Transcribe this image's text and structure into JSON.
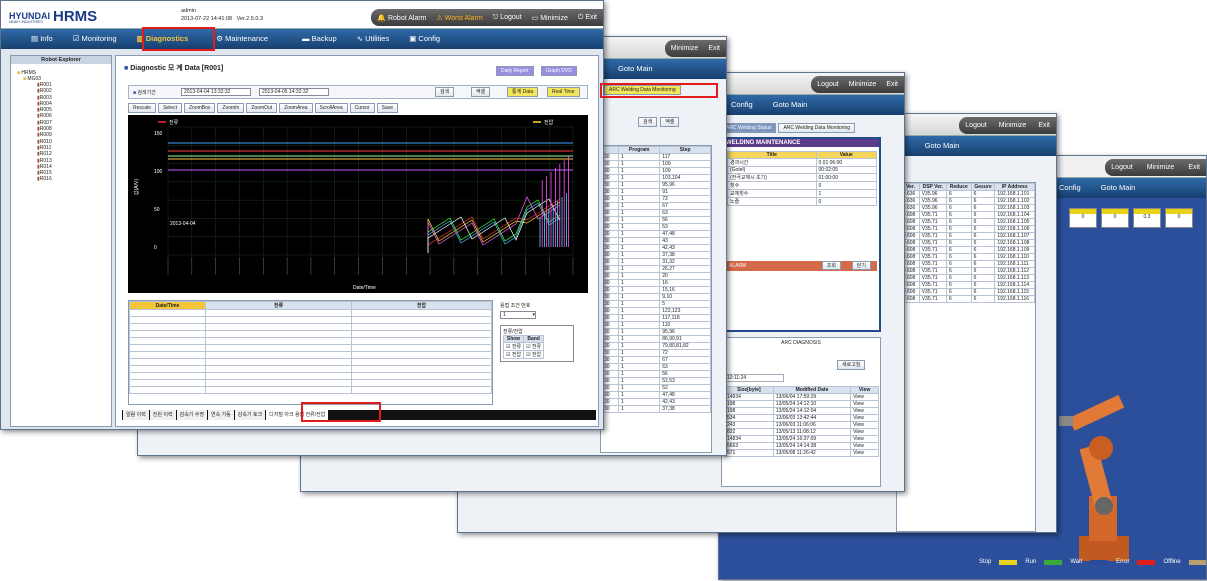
{
  "app": {
    "logo_brand": "HYUNDAI",
    "logo_sub": "HEAVY INDUSTRIES",
    "logo_product": "HRMS",
    "user": "admin",
    "datetime": "2013-07-22 14:41:08",
    "version": "Ver.2.5.0.3"
  },
  "topbar": {
    "robot_alarm": "Robot Alarm",
    "worst_alarm": "Worst Alarm",
    "logout": "Logout",
    "minimize": "Minimize",
    "exit": "Exit"
  },
  "nav": {
    "tabs": [
      "Info",
      "Monitoring",
      "Diagnostics",
      "Maintenance",
      "Backup",
      "Utilities",
      "Config"
    ],
    "goto_main": "Goto Main"
  },
  "explorer": {
    "title": "Robot Explorer",
    "root": "HRMS",
    "group": "MG03",
    "robots": [
      "R001",
      "R002",
      "R003",
      "R004",
      "R005",
      "R006",
      "R007",
      "R008",
      "R009",
      "R010",
      "R011",
      "R012",
      "R013",
      "R014",
      "R015",
      "R016"
    ]
  },
  "diagnostic": {
    "title": "Diagnostic 모 계 Data [R001]",
    "daily_report": "Daily Report",
    "graph_dvd": "Graph DVD",
    "period_label": "검색기간",
    "date_from": "2013-04-04 13:32:32",
    "date_to": "2013-04-05 14:32:32",
    "search": "검색",
    "print": "엑셀",
    "stats_data": "통계 Data",
    "real_time": "Real Time",
    "toolbar": [
      "Rescale",
      "Select",
      "ZoomBox",
      "ZoomIn",
      "ZoomOut",
      "ZoomArea",
      "ScrollArea",
      "Cursor",
      "Save"
    ],
    "legend_left": "전류",
    "legend_right": "전압",
    "y_axis_label": "값(A/V)",
    "x_axis_label": "Date/Time",
    "chart_date": "2013-04-04",
    "y_ticks": [
      "150",
      "100",
      "50",
      "0"
    ],
    "table_headers": [
      "Date/Time",
      "전류",
      "전압"
    ],
    "side_label": "용접 조건 번호",
    "side_value": "1",
    "show_label": "전류/전압",
    "show_col": "Show",
    "band_col": "Band",
    "opt1": "전류",
    "opt2": "전압",
    "bottom_tabs": [
      "알람 이력",
      "전원 이력",
      "감속기 수명",
      "연속 가동",
      "감속기 토크",
      "디지털 아크 용접 전류/전압"
    ]
  },
  "win2": {
    "tab": "ARC Welding Data Monitoring",
    "headers": [
      "",
      "Program",
      "Step"
    ],
    "rows": [
      [
        "30",
        "1",
        "117"
      ],
      [
        "30",
        "1",
        "109"
      ],
      [
        "30",
        "1",
        "109"
      ],
      [
        "30",
        "1",
        "103,104"
      ],
      [
        "30",
        "1",
        "95,96"
      ],
      [
        "30",
        "1",
        "91"
      ],
      [
        "30",
        "1",
        "72"
      ],
      [
        "30",
        "1",
        "67"
      ],
      [
        "30",
        "1",
        "63"
      ],
      [
        "30",
        "1",
        "56"
      ],
      [
        "30",
        "1",
        "53"
      ],
      [
        "30",
        "1",
        "47,48"
      ],
      [
        "30",
        "1",
        "43"
      ],
      [
        "30",
        "1",
        "42,43"
      ],
      [
        "30",
        "1",
        "37,38"
      ],
      [
        "30",
        "1",
        "31,32"
      ],
      [
        "30",
        "1",
        "26,27"
      ],
      [
        "30",
        "1",
        "20"
      ],
      [
        "30",
        "1",
        "16"
      ],
      [
        "30",
        "1",
        "15,16"
      ],
      [
        "30",
        "1",
        "9,10"
      ],
      [
        "30",
        "1",
        "5"
      ],
      [
        "30",
        "1",
        "122,123"
      ],
      [
        "30",
        "1",
        "117,118"
      ],
      [
        "30",
        "1",
        "110"
      ],
      [
        "30",
        "1",
        "95,96"
      ],
      [
        "30",
        "1",
        "86,90,91"
      ],
      [
        "30",
        "1",
        "79,80,81,82"
      ],
      [
        "30",
        "1",
        "72"
      ],
      [
        "30",
        "1",
        "67"
      ],
      [
        "30",
        "1",
        "63"
      ],
      [
        "30",
        "1",
        "56"
      ],
      [
        "30",
        "1",
        "52,53"
      ],
      [
        "30",
        "1",
        "52"
      ],
      [
        "30",
        "1",
        "47,48"
      ],
      [
        "30",
        "1",
        "42,43"
      ],
      [
        "30",
        "1",
        "37,38"
      ]
    ]
  },
  "win3": {
    "tabs": [
      "ARC Welding Status",
      "ARC Welding Data Monitoring"
    ],
    "section": "WELDING MAINTENANCE",
    "headers": [
      "Title",
      "Value"
    ],
    "rows": [
      [
        "경과시간",
        "0 01 06:00"
      ],
      [
        "(Gotel)",
        "00:02:05"
      ],
      [
        "(전극교체시 초기)",
        "01:00:00"
      ],
      [
        "횟수",
        "0"
      ],
      [
        "교체횟수",
        "1"
      ],
      [
        "노즐",
        "0"
      ]
    ],
    "alarm_label": "ALARM",
    "alarm_btn1": "조회",
    "alarm_btn2": "닫기",
    "diag_label": "ARC DIAGNOSIS",
    "new_btn": "새로고침",
    "diag_time": "10:11:24",
    "diag_headers": [
      "Size[byte]",
      "Modified Date",
      "View"
    ],
    "diag_rows": [
      [
        "14834",
        "13/06/04 17:59:29",
        "View"
      ],
      [
        "198",
        "13/05/24 14:12:10",
        "View"
      ],
      [
        "198",
        "13/05/24 14:12:04",
        "View"
      ],
      [
        "534",
        "13/06/03 13:42:44",
        "View"
      ],
      [
        "243",
        "13/06/03 11:06:06",
        "View"
      ],
      [
        "822",
        "13/05/13 11:08:12",
        "View"
      ],
      [
        "14834",
        "13/05/24 16:37:09",
        "View"
      ],
      [
        "5663",
        "13/05/24 14:14:38",
        "View"
      ],
      [
        "571",
        "13/05/08 11:26:42",
        "View"
      ]
    ]
  },
  "win4": {
    "headers": [
      "F Ver.",
      "DSP Ver.",
      "Reduce",
      "Gesure",
      "IP Address"
    ],
    "rows": [
      [
        "19.636",
        "V35.96",
        "6",
        "6",
        "192.168.1.101"
      ],
      [
        "19.636",
        "V35.96",
        "6",
        "6",
        "192.168.1.102"
      ],
      [
        "19.636",
        "V35.96",
        "6",
        "6",
        "192.168.1.103"
      ],
      [
        "09.608",
        "V35.71",
        "6",
        "6",
        "192.168.1.104"
      ],
      [
        "09.608",
        "V35.71",
        "6",
        "6",
        "192.168.1.105"
      ],
      [
        "09.608",
        "V35.71",
        "6",
        "6",
        "192.168.1.106"
      ],
      [
        "09.608",
        "V35.71",
        "6",
        "6",
        "192.168.1.107"
      ],
      [
        "09.608",
        "V35.71",
        "6",
        "6",
        "192.168.1.108"
      ],
      [
        "09.608",
        "V35.71",
        "6",
        "6",
        "192.168.1.109"
      ],
      [
        "09.608",
        "V35.71",
        "6",
        "6",
        "192.168.1.110"
      ],
      [
        "09.608",
        "V35.71",
        "6",
        "6",
        "192.168.1.111"
      ],
      [
        "09.608",
        "V35.71",
        "6",
        "6",
        "192.168.1.112"
      ],
      [
        "09.608",
        "V35.71",
        "6",
        "6",
        "192.168.1.113"
      ],
      [
        "09.608",
        "V35.71",
        "6",
        "6",
        "192.168.1.114"
      ],
      [
        "09.608",
        "V35.71",
        "6",
        "6",
        "192.168.1.115"
      ],
      [
        "09.608",
        "V35.71",
        "6",
        "6",
        "192.168.1.116"
      ]
    ]
  },
  "win5": {
    "cells": [
      "0",
      "0",
      "0.3",
      "0"
    ],
    "status_legend": [
      "Stop",
      "Run",
      "Wait",
      "Error",
      "Offline"
    ],
    "status_colors": [
      "#e8d21a",
      "#3aa83a",
      "#2a4a9a",
      "#e21b1b",
      "#b8a070"
    ]
  }
}
